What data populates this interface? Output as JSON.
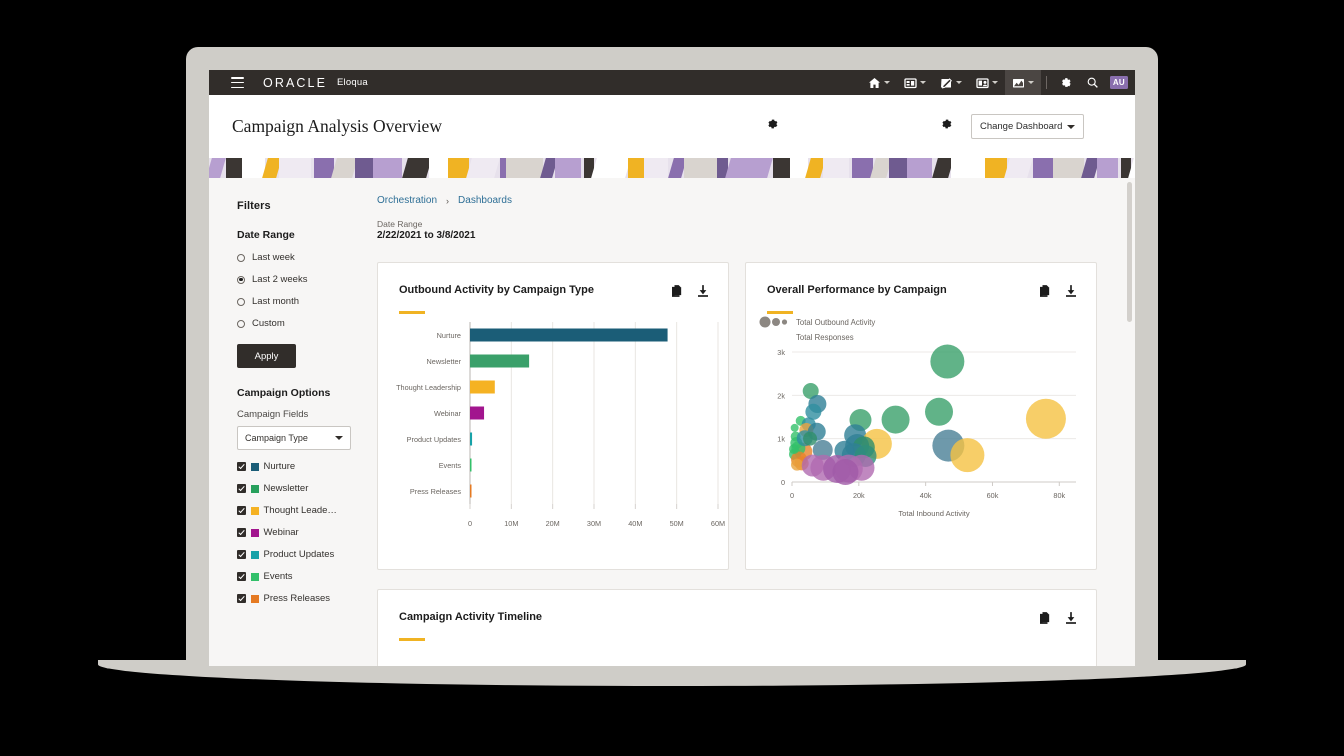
{
  "topbar": {
    "menu_icon": "hamburger-icon",
    "brand": "ORACLE",
    "product": "Eloqua",
    "nav": [
      {
        "name": "home-icon",
        "label": "Home",
        "active": false
      },
      {
        "name": "assets-icon",
        "label": "Assets",
        "active": false
      },
      {
        "name": "edit-icon",
        "label": "Create",
        "active": false
      },
      {
        "name": "contacts-icon",
        "label": "Audience",
        "active": false
      },
      {
        "name": "analytics-icon",
        "label": "Analytics",
        "active": true
      }
    ],
    "settings_icon": "gear-icon",
    "search_icon": "search-icon",
    "avatar_initials": "AU",
    "avatar_color": "#8a6fae"
  },
  "header": {
    "title": "Campaign Analysis Overview",
    "gear_left": "gear-icon",
    "gear_right": "gear-icon",
    "dashboard_select": "Change Dashboard"
  },
  "sidebar": {
    "filters_title": "Filters",
    "date_range_title": "Date Range",
    "date_options": [
      {
        "label": "Last week",
        "selected": false
      },
      {
        "label": "Last 2 weeks",
        "selected": true
      },
      {
        "label": "Last month",
        "selected": false
      },
      {
        "label": "Custom",
        "selected": false
      }
    ],
    "apply_label": "Apply",
    "campaign_options_title": "Campaign Options",
    "campaign_fields_label": "Campaign Fields",
    "campaign_fields_value": "Campaign Type",
    "campaign_types": [
      {
        "label": "Nurture",
        "color": "#1b5d77",
        "checked": true
      },
      {
        "label": "Newsletter",
        "color": "#27a05c",
        "checked": true
      },
      {
        "label": "Thought Leade…",
        "color": "#f5b223",
        "checked": true
      },
      {
        "label": "Webinar",
        "color": "#a2158e",
        "checked": true
      },
      {
        "label": "Product Updates",
        "color": "#17a2a8",
        "checked": true
      },
      {
        "label": "Events",
        "color": "#33c06a",
        "checked": true
      },
      {
        "label": "Press Releases",
        "color": "#e57a22",
        "checked": true
      }
    ]
  },
  "content": {
    "breadcrumb": [
      {
        "label": "Orchestration"
      },
      {
        "label": "Dashboards"
      }
    ],
    "breadcrumb_separator": "›",
    "date_range_label": "Date Range",
    "date_range_value": "2/22/2021 to 3/8/2021",
    "card_icons": {
      "copy": "document-copy-icon",
      "download": "download-icon"
    }
  },
  "chart_data": [
    {
      "type": "bar",
      "title": "Outbound Activity by Campaign Type",
      "orientation": "horizontal",
      "categories": [
        "Nurture",
        "Newsletter",
        "Thought Leadership",
        "Webinar",
        "Product Updates",
        "Events",
        "Press Releases"
      ],
      "values": [
        47800000,
        14300000,
        6000000,
        3400000,
        500000,
        330000,
        250000
      ],
      "colors": [
        "#1b5d77",
        "#3aa06a",
        "#f5b223",
        "#a2158e",
        "#17a2a8",
        "#33c06a",
        "#e57a22"
      ],
      "xlabel": "",
      "ylabel": "",
      "xlim": [
        0,
        60000000
      ],
      "xticks": [
        0,
        10000000,
        20000000,
        30000000,
        40000000,
        50000000,
        60000000
      ],
      "xticklabels": [
        "0",
        "10M",
        "20M",
        "30M",
        "40M",
        "50M",
        "60M"
      ],
      "grid": true,
      "legend": "none"
    },
    {
      "type": "scatter",
      "title": "Overall Performance by Campaign",
      "xlabel": "Total Inbound Activity",
      "ylabel": "Total Responses",
      "size_legend_label": "Total Outbound Activity",
      "xlim": [
        0,
        85000
      ],
      "ylim": [
        0,
        3000
      ],
      "xticks": [
        0,
        20000,
        40000,
        60000,
        80000
      ],
      "xticklabels": [
        "0",
        "20k",
        "40k",
        "60k",
        "80k"
      ],
      "yticks": [
        0,
        1000,
        2000,
        3000
      ],
      "yticklabels": [
        "0",
        "1k",
        "2k",
        "3k"
      ],
      "grid": true,
      "legend": "size",
      "points": [
        {
          "x": 46500,
          "y": 2780,
          "r": 17,
          "color": "#3aa06a"
        },
        {
          "x": 5600,
          "y": 2100,
          "r": 8,
          "color": "#3aa06a"
        },
        {
          "x": 7600,
          "y": 1800,
          "r": 9,
          "color": "#2f7f96"
        },
        {
          "x": 6400,
          "y": 1620,
          "r": 8,
          "color": "#2f8fa0"
        },
        {
          "x": 44000,
          "y": 1620,
          "r": 14,
          "color": "#3aa06a"
        },
        {
          "x": 76000,
          "y": 1460,
          "r": 20,
          "color": "#f5c councils"
        },
        {
          "x": 31000,
          "y": 1440,
          "r": 14,
          "color": "#3aa06a"
        },
        {
          "x": 20500,
          "y": 1430,
          "r": 11,
          "color": "#3aa06a"
        },
        {
          "x": 2600,
          "y": 1410,
          "r": 5,
          "color": "#33c06a"
        },
        {
          "x": 5000,
          "y": 1330,
          "r": 7,
          "color": "#2f8fa0"
        },
        {
          "x": 4300,
          "y": 1200,
          "r": 7,
          "color": "#e8a33d"
        },
        {
          "x": 7400,
          "y": 1160,
          "r": 9,
          "color": "#2f7f96"
        },
        {
          "x": 18900,
          "y": 1080,
          "r": 11,
          "color": "#2f7f96"
        },
        {
          "x": 25400,
          "y": 880,
          "r": 15,
          "color": "#f5c242"
        },
        {
          "x": 46800,
          "y": 840,
          "r": 16,
          "color": "#4a7f96"
        },
        {
          "x": 19500,
          "y": 830,
          "r": 12,
          "color": "#2f7f96"
        },
        {
          "x": 21500,
          "y": 800,
          "r": 11,
          "color": "#2f8f6a"
        },
        {
          "x": 9200,
          "y": 740,
          "r": 10,
          "color": "#4a7f96"
        },
        {
          "x": 15700,
          "y": 720,
          "r": 10,
          "color": "#2f7f96"
        },
        {
          "x": 52500,
          "y": 620,
          "r": 17,
          "color": "#f5c242"
        },
        {
          "x": 18500,
          "y": 620,
          "r": 12,
          "color": "#2f7f96"
        },
        {
          "x": 22000,
          "y": 600,
          "r": 11,
          "color": "#2f8f7a"
        },
        {
          "x": 3400,
          "y": 700,
          "r": 9,
          "color": "#e8832a"
        },
        {
          "x": 1900,
          "y": 780,
          "r": 7,
          "color": "#33c06a"
        },
        {
          "x": 1300,
          "y": 900,
          "r": 6,
          "color": "#33c06a"
        },
        {
          "x": 1100,
          "y": 1050,
          "r": 5,
          "color": "#33c06a"
        },
        {
          "x": 900,
          "y": 640,
          "r": 6,
          "color": "#33c06a"
        },
        {
          "x": 2100,
          "y": 520,
          "r": 8,
          "color": "#e8832a"
        },
        {
          "x": 2900,
          "y": 430,
          "r": 7,
          "color": "#e8832a"
        },
        {
          "x": 1500,
          "y": 400,
          "r": 6,
          "color": "#e8a33d"
        },
        {
          "x": 6200,
          "y": 380,
          "r": 11,
          "color": "#b06ab0"
        },
        {
          "x": 9400,
          "y": 330,
          "r": 13,
          "color": "#b06ab0"
        },
        {
          "x": 13500,
          "y": 300,
          "r": 14,
          "color": "#a05aa8"
        },
        {
          "x": 17000,
          "y": 310,
          "r": 14,
          "color": "#b06ab0"
        },
        {
          "x": 20800,
          "y": 330,
          "r": 13,
          "color": "#b06ab0"
        },
        {
          "x": 16000,
          "y": 230,
          "r": 13,
          "color": "#a05aa8"
        },
        {
          "x": 3800,
          "y": 1010,
          "r": 8,
          "color": "#2f8fa0"
        },
        {
          "x": 5400,
          "y": 1000,
          "r": 7,
          "color": "#2f8f6a"
        },
        {
          "x": 800,
          "y": 1250,
          "r": 4,
          "color": "#33c06a"
        },
        {
          "x": 600,
          "y": 760,
          "r": 5,
          "color": "#33c06a"
        }
      ]
    },
    {
      "type": "timeline",
      "title": "Campaign Activity Timeline"
    }
  ]
}
